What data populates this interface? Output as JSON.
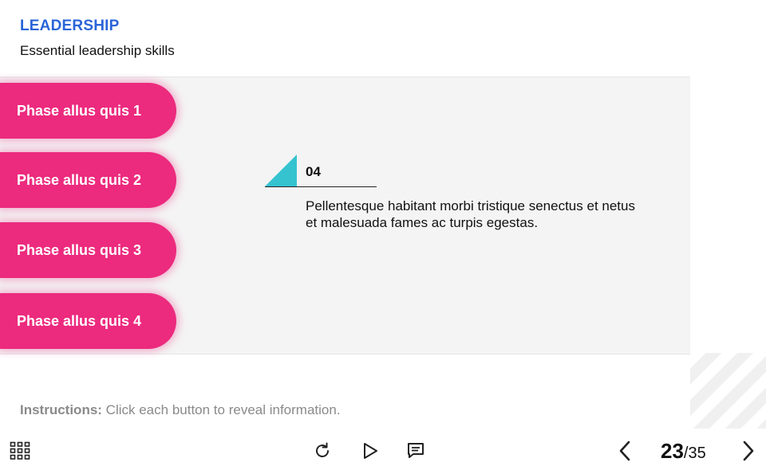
{
  "header": {
    "title": "LEADERSHIP",
    "subtitle": "Essential leadership skills"
  },
  "phases": [
    {
      "label": "Phase allus quis 1"
    },
    {
      "label": "Phase allus quis 2"
    },
    {
      "label": "Phase allus quis 3"
    },
    {
      "label": "Phase allus quis 4"
    }
  ],
  "info": {
    "number": "04",
    "text": "Pellentesque habitant morbi tristique senectus et netus et malesuada fames ac turpis egestas.",
    "accent_color": "#35c3cf"
  },
  "instructions": {
    "label": "Instructions:",
    "text": " Click each button to reveal information."
  },
  "footer": {
    "menu_icon": "grid-menu-icon",
    "replay_icon": "replay-icon",
    "play_icon": "play-icon",
    "comment_icon": "comment-icon",
    "prev_icon": "chevron-left-icon",
    "next_icon": "chevron-right-icon",
    "page_current": "23",
    "page_total": "/35"
  },
  "colors": {
    "title": "#2a64d8",
    "button": "#ec2a7e",
    "panel": "#f4f4f4"
  }
}
